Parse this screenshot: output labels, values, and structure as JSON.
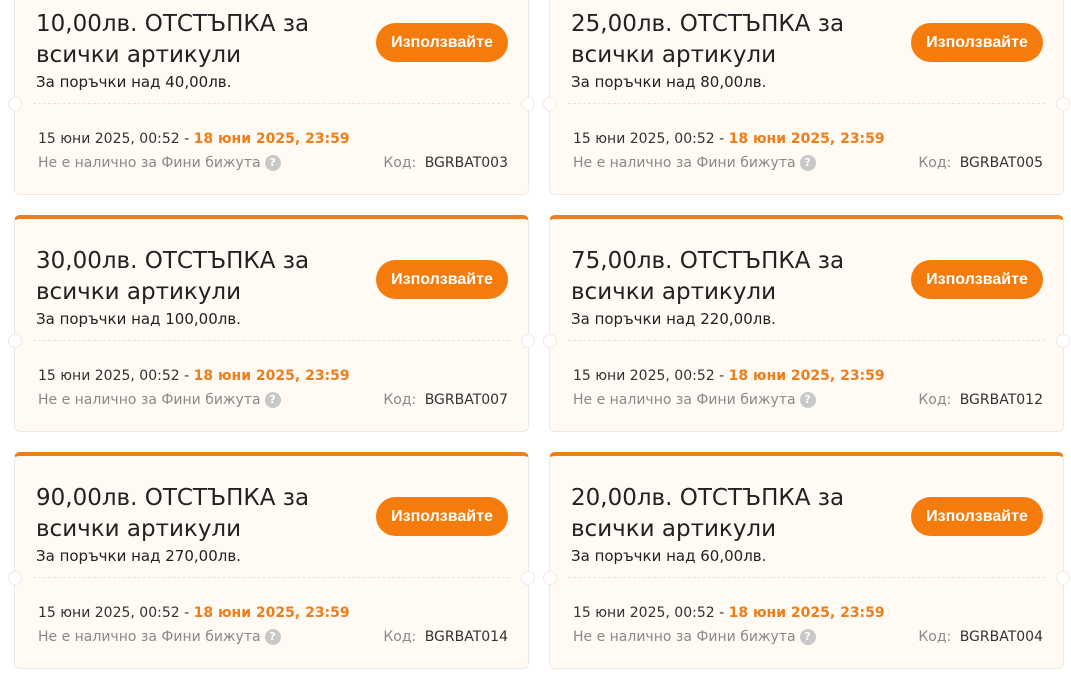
{
  "coupons": [
    {
      "title": "10,00лв. ОТСТЪПКА за всички артикули",
      "condition": "За поръчки над 40,00лв.",
      "button": "Използвайте",
      "date_start": "15 юни 2025, 00:52 -",
      "date_end": "18 юни 2025, 23:59",
      "note": "Не е налично за Фини бижута",
      "code_label": "Код:",
      "code": "BGRBAT003"
    },
    {
      "title": "25,00лв. ОТСТЪПКА за всички артикули",
      "condition": "За поръчки над 80,00лв.",
      "button": "Използвайте",
      "date_start": "15 юни 2025, 00:52 -",
      "date_end": "18 юни 2025, 23:59",
      "note": "Не е налично за Фини бижута",
      "code_label": "Код:",
      "code": "BGRBAT005"
    },
    {
      "title": "30,00лв. ОТСТЪПКА за всички артикули",
      "condition": "За поръчки над 100,00лв.",
      "button": "Използвайте",
      "date_start": "15 юни 2025, 00:52 -",
      "date_end": "18 юни 2025, 23:59",
      "note": "Не е налично за Фини бижута",
      "code_label": "Код:",
      "code": "BGRBAT007"
    },
    {
      "title": "75,00лв. ОТСТЪПКА за всички артикули",
      "condition": "За поръчки над 220,00лв.",
      "button": "Използвайте",
      "date_start": "15 юни 2025, 00:52 -",
      "date_end": "18 юни 2025, 23:59",
      "note": "Не е налично за Фини бижута",
      "code_label": "Код:",
      "code": "BGRBAT012"
    },
    {
      "title": "90,00лв. ОТСТЪПКА за всички артикули",
      "condition": "За поръчки над 270,00лв.",
      "button": "Използвайте",
      "date_start": "15 юни 2025, 00:52 -",
      "date_end": "18 юни 2025, 23:59",
      "note": "Не е налично за Фини бижута",
      "code_label": "Код:",
      "code": "BGRBAT014"
    },
    {
      "title": "20,00лв. ОТСТЪПКА за всички артикули",
      "condition": "За поръчки над 60,00лв.",
      "button": "Използвайте",
      "date_start": "15 юни 2025, 00:52 -",
      "date_end": "18 юни 2025, 23:59",
      "note": "Не е налично за Фини бижута",
      "code_label": "Код:",
      "code": "BGRBAT004"
    }
  ],
  "icons": {
    "help": "question-mark-circle-icon",
    "help_glyph": "?"
  },
  "colors": {
    "accent": "#f57c0c",
    "end_date": "#ef7d1a",
    "card_background": "#fffaf4"
  }
}
